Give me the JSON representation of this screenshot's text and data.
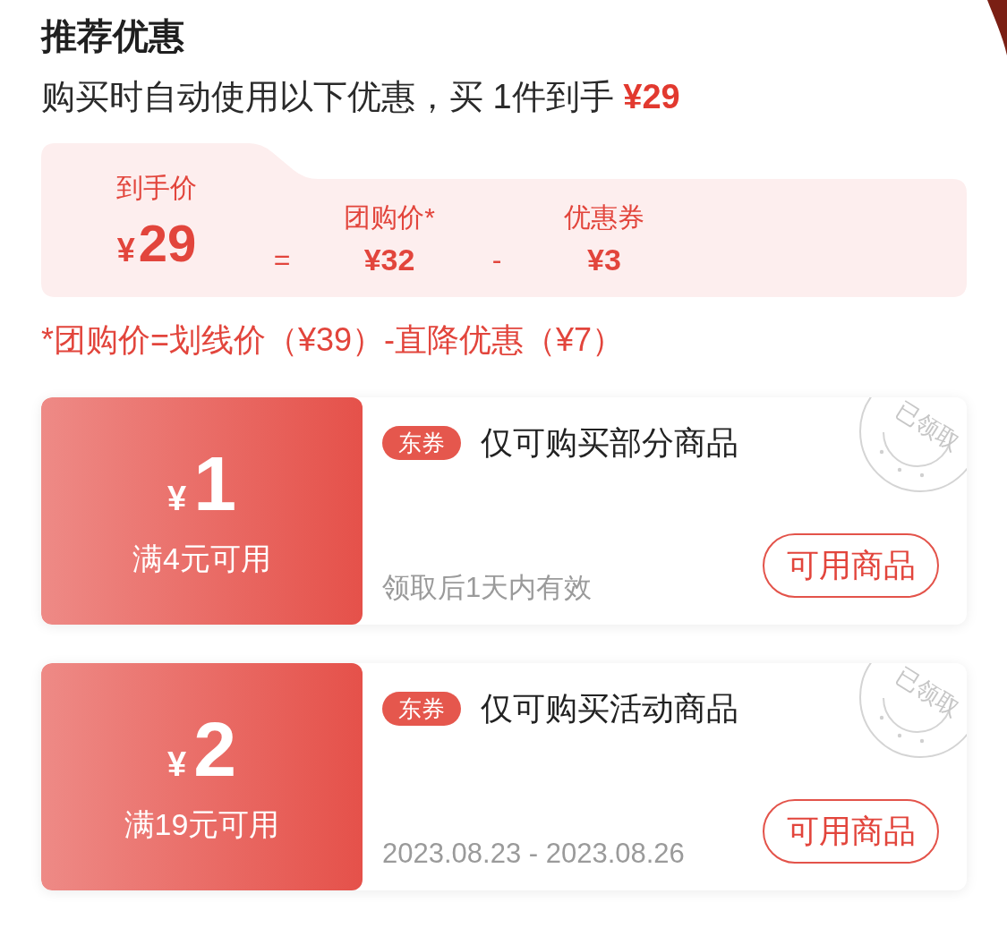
{
  "header": {
    "title": "推荐优惠",
    "subtitle": "购买时自动使用以下优惠，买 1件到手",
    "subtitle_amount": "¥29"
  },
  "price_breakdown": {
    "final": {
      "label": "到手价",
      "currency": "¥",
      "amount": "29"
    },
    "terms": [
      {
        "operator": "=",
        "label": "团购价*",
        "value": "¥32"
      },
      {
        "operator": "-",
        "label": "优惠券",
        "value": "¥3"
      }
    ]
  },
  "note": "*团购价=划线价（¥39）-直降优惠（¥7）",
  "coupons": [
    {
      "currency": "¥",
      "amount": "1",
      "condition": "满4元可用",
      "tag": "东券",
      "title": "仅可购买部分商品",
      "validity": "领取后1天内有效",
      "button": "可用商品",
      "stamp": "已领取"
    },
    {
      "currency": "¥",
      "amount": "2",
      "condition": "满19元可用",
      "tag": "东券",
      "title": "仅可购买活动商品",
      "validity": "2023.08.23 - 2023.08.26",
      "button": "可用商品",
      "stamp": "已领取"
    }
  ]
}
